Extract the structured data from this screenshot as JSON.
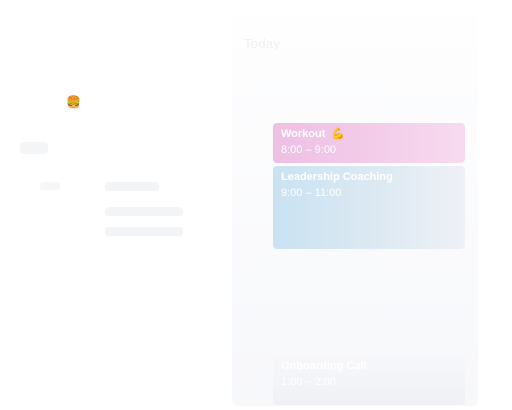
{
  "header": {
    "title": "Today"
  },
  "left": {
    "emoji": "🍔"
  },
  "events": [
    {
      "title": "Workout",
      "emoji": "💪",
      "time": "8:00 – 9:00"
    },
    {
      "title": "Leadership Coaching",
      "time": "9:00 – 11:00"
    },
    {
      "title": "Onboarding Call",
      "time": "1:00 – 2:00"
    }
  ],
  "colors": {
    "workout": "#eebfe3",
    "leadership": "#c9e2f2",
    "background": "#ffffff"
  }
}
